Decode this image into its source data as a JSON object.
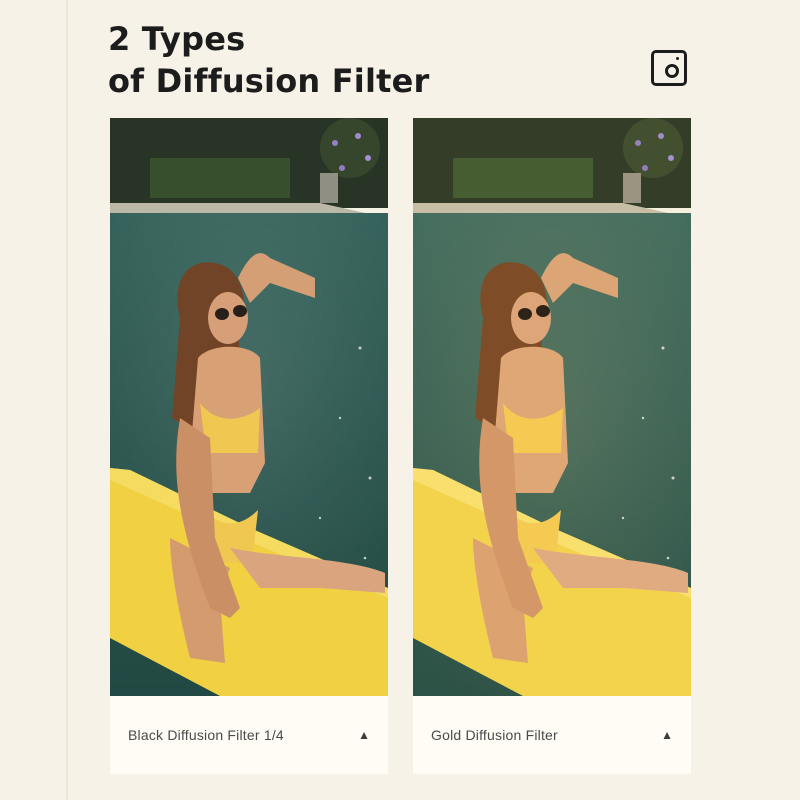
{
  "title": {
    "line1": "2 Types",
    "line2": "of Diffusion Filter"
  },
  "header_icon": "instagram-icon",
  "cards": [
    {
      "label": "Black Diffusion Filter 1/4",
      "arrow": "▲",
      "tone": "black-diffusion"
    },
    {
      "label": "Gold Diffusion Filter",
      "arrow": "▲",
      "tone": "gold-diffusion"
    }
  ],
  "colors": {
    "background": "#f6f2e7",
    "caption_bg": "#fefcf4",
    "title": "#1c1c1c",
    "pool_water": "#1f4f4a",
    "surfboard": "#f1cf3a"
  }
}
